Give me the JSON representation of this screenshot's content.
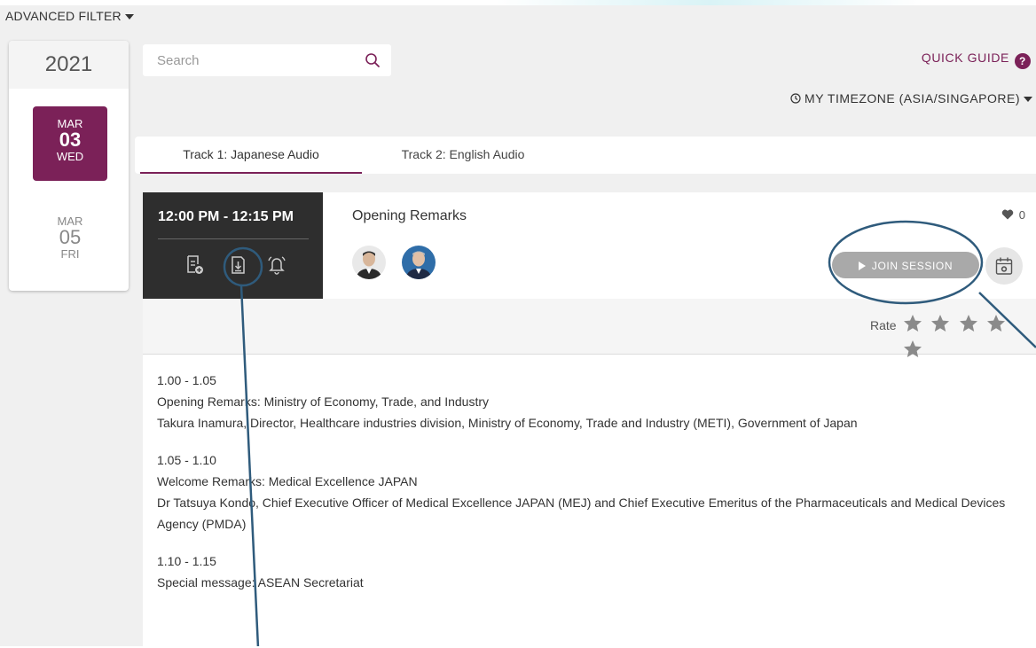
{
  "filter": {
    "label": "ADVANCED FILTER"
  },
  "calendar": {
    "year": "2021",
    "dates": [
      {
        "month": "MAR",
        "day": "03",
        "weekday": "WED",
        "active": true
      },
      {
        "month": "MAR",
        "day": "05",
        "weekday": "FRI",
        "active": false
      }
    ]
  },
  "search": {
    "placeholder": "Search",
    "value": ""
  },
  "header": {
    "quick_guide": "QUICK GUIDE",
    "timezone": "MY TIMEZONE (ASIA/SINGAPORE)"
  },
  "tabs": [
    {
      "label": "Track 1: Japanese Audio",
      "active": true
    },
    {
      "label": "Track 2: English Audio",
      "active": false
    }
  ],
  "session": {
    "time": "12:00 PM - 12:15 PM",
    "title": "Opening Remarks",
    "likes": "0",
    "join_label": "JOIN SESSION",
    "rate_label": "Rate",
    "rating_stars": 5,
    "description": [
      "1.00 - 1.05",
      "Opening Remarks:  Ministry of Economy, Trade, and Industry",
      "Takura Inamura, Director, Healthcare industries division, Ministry of Economy, Trade and Industry (METI), Government of Japan",
      "1.05 - 1.10",
      "Welcome Remarks: Medical Excellence JAPAN",
      "Dr Tatsuya Kondo, Chief Executive Officer of Medical Excellence JAPAN (MEJ) and Chief Executive Emeritus of the Pharmaceuticals and Medical Devices Agency (PMDA)",
      "1.10 - 1.15",
      "Special message: ASEAN Secretariat"
    ]
  },
  "icons": {
    "search": "search-icon",
    "help": "help-icon",
    "clock": "clock-icon",
    "add_note": "add-note-icon",
    "download": "download-icon",
    "reminder": "bell-icon",
    "heart": "heart-icon",
    "calendar": "add-calendar-icon",
    "star": "star-icon"
  },
  "colors": {
    "accent": "#7b2158",
    "time_block": "#2e2e2e",
    "join_button": "#a9a9a9",
    "annotation": "#2f5b7c"
  }
}
